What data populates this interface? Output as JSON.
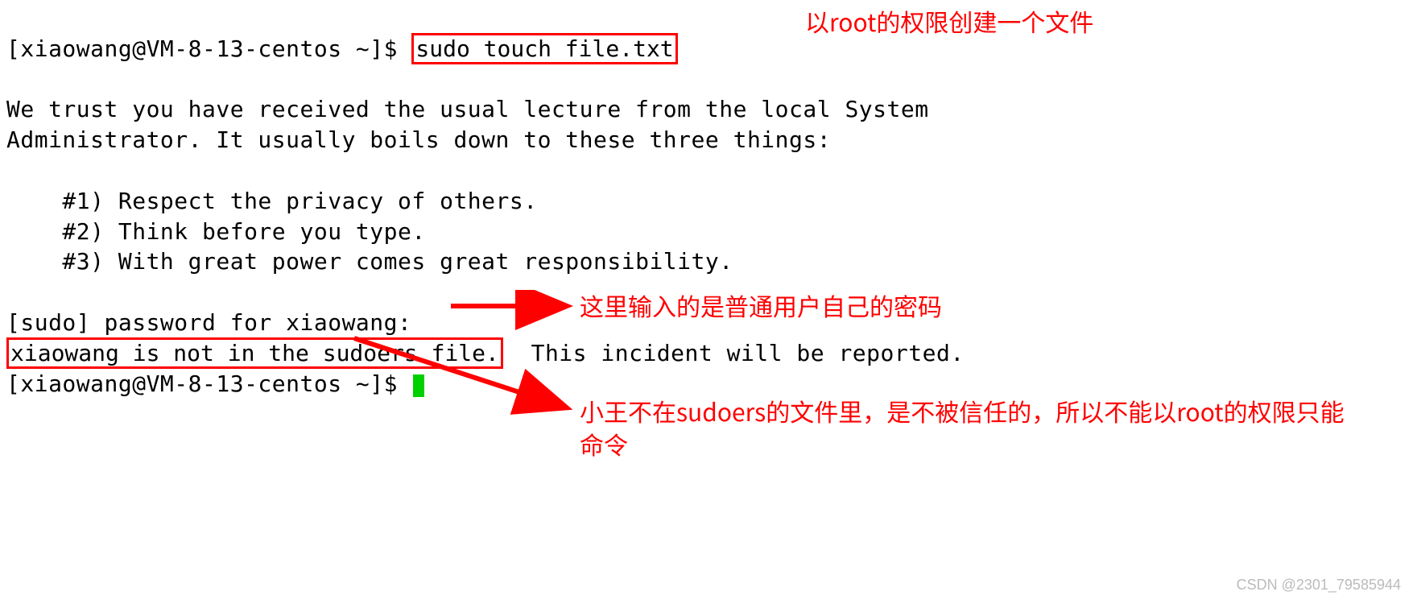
{
  "terminal": {
    "prompt1_pre": "[xiaowang@VM-8-13-centos ~]$ ",
    "command": "sudo touch file.txt",
    "lecture_l1": "We trust you have received the usual lecture from the local System",
    "lecture_l2": "Administrator. It usually boils down to these three things:",
    "rule1": "    #1) Respect the privacy of others.",
    "rule2": "    #2) Think before you type.",
    "rule3": "    #3) With great power comes great responsibility.",
    "pw_prompt": "[sudo] password for xiaowang: ",
    "error_hl": "xiaowang is not in the sudoers file.",
    "error_rest": "  This incident will be reported.",
    "prompt2": "[xiaowang@VM-8-13-centos ~]$ "
  },
  "annotations": {
    "a1": "以root的权限创建一个文件",
    "a2": "这里输入的是普通用户自己的密码",
    "a3": "小王不在sudoers的文件里，是不被信任的，所以不能以root的权限只能命令"
  },
  "watermark": "CSDN @2301_79585944"
}
